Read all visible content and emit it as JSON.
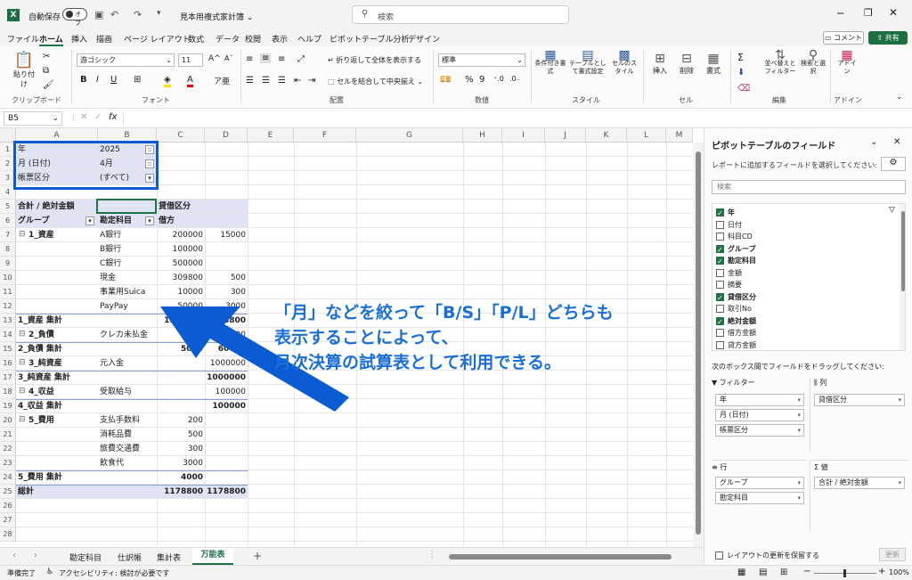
{
  "titlebar": {
    "autosave": "自動保存",
    "autosave_state": "オフ",
    "filename": "見本用複式家計簿 ⌄",
    "search_placeholder": "検索"
  },
  "menu": {
    "tabs": [
      "ファイル",
      "ホーム",
      "挿入",
      "描画",
      "ページ レイアウト",
      "数式",
      "データ",
      "校閲",
      "表示",
      "ヘルプ",
      "ピボットテーブル分析",
      "デザイン"
    ],
    "comment": "コメント",
    "share": "共有"
  },
  "ribbon": {
    "paste": "貼り付け",
    "clipboard": "クリップボード",
    "font_name": "游ゴシック",
    "font_size": "11",
    "font_group": "フォント",
    "wrap": "折り返して全体を表示する",
    "merge": "セルを結合して中央揃え",
    "align_group": "配置",
    "number_format": "標準",
    "number_group": "数値",
    "cond_format": "条件付き書式",
    "table_format": "テーブルとして書式設定",
    "cell_style": "セルのスタイル",
    "style_group": "スタイル",
    "insert": "挿入",
    "delete": "削除",
    "format": "書式",
    "cell_group": "セル",
    "sort": "並べ替えとフィルター",
    "find": "検索と選択",
    "edit_group": "編集",
    "addin": "アドイン",
    "addin_group": "アドイン"
  },
  "formula": {
    "namebox": "B5",
    "fx": "fx"
  },
  "columns": [
    "A",
    "B",
    "C",
    "D",
    "E",
    "F",
    "G",
    "H",
    "I",
    "J",
    "K",
    "L",
    "M"
  ],
  "rows": [
    "1",
    "2",
    "3",
    "4",
    "5",
    "6",
    "7",
    "8",
    "9",
    "10",
    "11",
    "12",
    "13",
    "14",
    "15",
    "16",
    "17",
    "18",
    "19",
    "20",
    "21",
    "22",
    "23",
    "24",
    "25",
    "26",
    "27",
    "28"
  ],
  "sheet": {
    "filters": [
      {
        "label": "年",
        "value": "2025"
      },
      {
        "label": "月 (日付)",
        "value": "4月"
      },
      {
        "label": "帳票区分",
        "value": "(すべて)"
      }
    ],
    "r5": {
      "a": "合計 / 絶対金額",
      "c": "貸借区分"
    },
    "r6": {
      "a": "グループ",
      "b": "勘定科目",
      "c": "借方"
    },
    "r7": {
      "a": "1_資産",
      "b": "A銀行",
      "c": "200000",
      "d": "15000"
    },
    "r8": {
      "b": "B銀行",
      "c": "100000"
    },
    "r9": {
      "b": "C銀行",
      "c": "500000"
    },
    "r10": {
      "b": "現金",
      "c": "309800",
      "d": "500"
    },
    "r11": {
      "b": "事業用Suica",
      "c": "10000",
      "d": "300"
    },
    "r12": {
      "b": "PayPay",
      "c": "50000",
      "d": "3000"
    },
    "r13": {
      "a": "1_資産 集計",
      "c": "1169800",
      "d": "18800"
    },
    "r14": {
      "a": "2_負債",
      "b": "クレカ未払金",
      "c": "5000",
      "d": "60000"
    },
    "r15": {
      "a": "2_負債 集計",
      "c": "5000",
      "d": "60000"
    },
    "r16": {
      "a": "3_純資産",
      "b": "元入金",
      "d": "1000000"
    },
    "r17": {
      "a": "3_純資産 集計",
      "d": "1000000"
    },
    "r18": {
      "a": "4_収益",
      "b": "受取給与",
      "d": "100000"
    },
    "r19": {
      "a": "4_収益 集計",
      "d": "100000"
    },
    "r20": {
      "a": "5_費用",
      "b": "支払手数料",
      "c": "200"
    },
    "r21": {
      "b": "消耗品費",
      "c": "500"
    },
    "r22": {
      "b": "旅費交通費",
      "c": "300"
    },
    "r23": {
      "b": "飲食代",
      "c": "3000"
    },
    "r24": {
      "a": "5_費用 集計",
      "c": "4000"
    },
    "r25": {
      "a": "総計",
      "c": "1178800",
      "d": "1178800"
    }
  },
  "annotation": {
    "line1": "「月」などを絞って「B/S」「P/L」どちらも",
    "line2": "表示することによって、",
    "line3": "月次決算の試算表として利用できる。",
    "color": "#1a6fd6"
  },
  "pane": {
    "title": "ピボットテーブルのフィールド",
    "subtitle": "レポートに追加するフィールドを選択してください:",
    "search": "検索",
    "fields": [
      {
        "name": "年",
        "on": true
      },
      {
        "name": "日付",
        "on": false
      },
      {
        "name": "科目CD",
        "on": false
      },
      {
        "name": "グループ",
        "on": true
      },
      {
        "name": "勘定科目",
        "on": true
      },
      {
        "name": "金額",
        "on": false
      },
      {
        "name": "摘要",
        "on": false
      },
      {
        "name": "貸借区分",
        "on": true
      },
      {
        "name": "取引No",
        "on": false
      },
      {
        "name": "絶対金額",
        "on": true
      },
      {
        "name": "借方金額",
        "on": false
      },
      {
        "name": "貸方金額",
        "on": false
      }
    ],
    "drag_hint": "次のボックス間でフィールドをドラッグしてください:",
    "filter_label": "フィルター",
    "col_label": "列",
    "row_label": "行",
    "val_label": "値",
    "filters": [
      "年",
      "月 (日付)",
      "帳票区分"
    ],
    "cols": [
      "貸借区分"
    ],
    "rows": [
      "グループ",
      "勘定科目"
    ],
    "vals": [
      "合計 / 絶対金額"
    ],
    "defer": "レイアウトの更新を保留する",
    "update": "更新"
  },
  "tabs": [
    "勘定科目",
    "仕訳帳",
    "集計表",
    "万能表"
  ],
  "status": {
    "ready": "準備完了",
    "access": "アクセシビリティ: 検討が必要です",
    "zoom": "100%"
  }
}
